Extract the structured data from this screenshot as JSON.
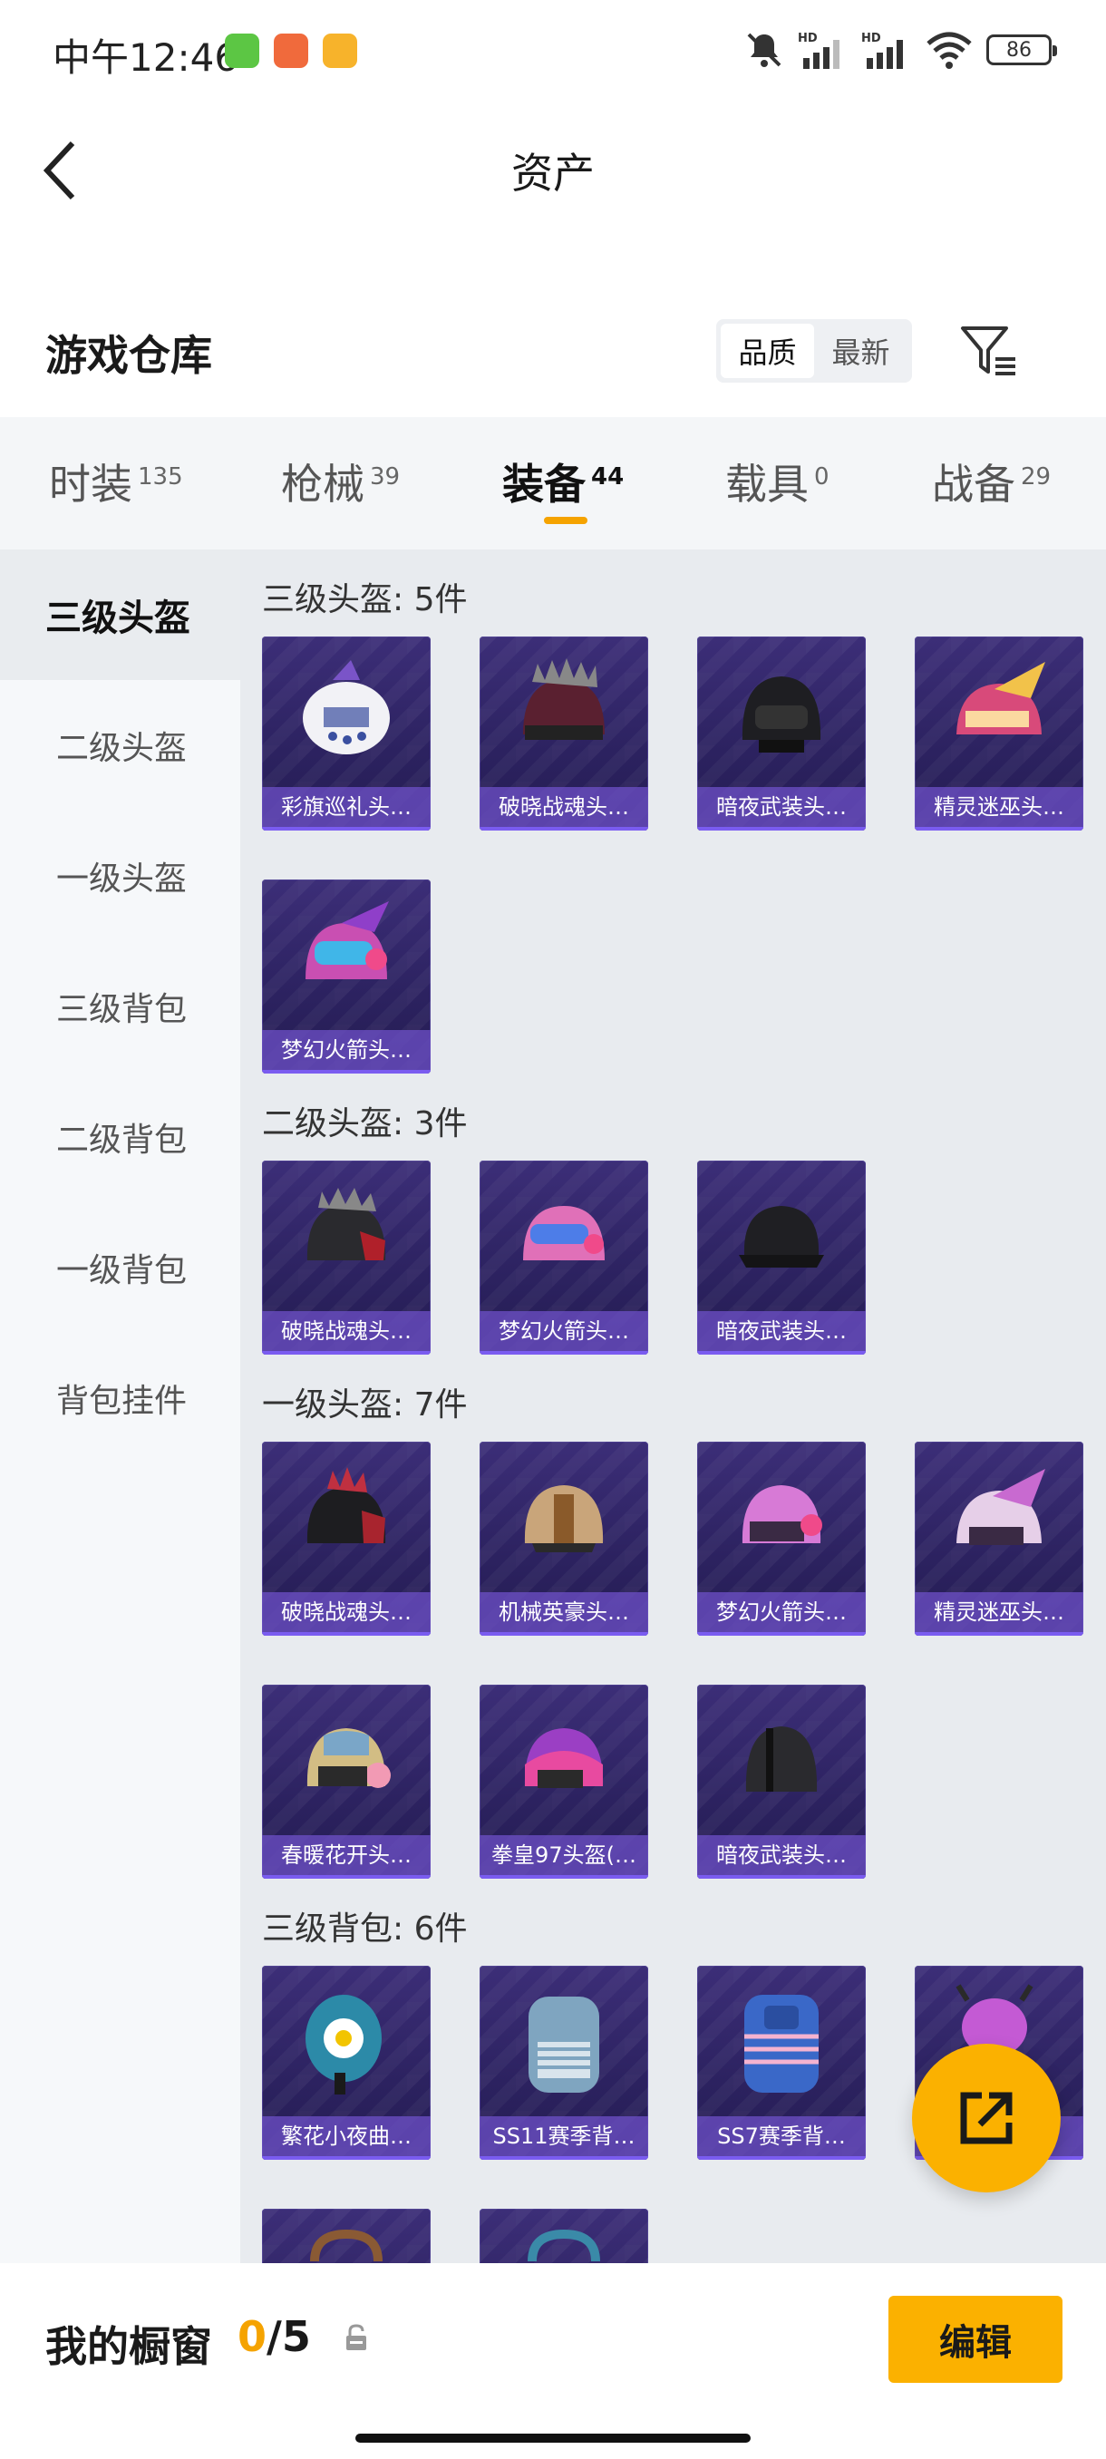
{
  "status_bar": {
    "time": "中午12:46",
    "battery": "86"
  },
  "header": {
    "title": "资产"
  },
  "warehouse": {
    "title": "游戏仓库",
    "sort_options": [
      "品质",
      "最新"
    ]
  },
  "tabs": [
    {
      "label": "时装",
      "count": "135"
    },
    {
      "label": "枪械",
      "count": "39"
    },
    {
      "label": "装备",
      "count": "44"
    },
    {
      "label": "载具",
      "count": "0"
    },
    {
      "label": "战备",
      "count": "29"
    }
  ],
  "sidebar": {
    "items": [
      "三级头盔",
      "二级头盔",
      "一级头盔",
      "三级背包",
      "二级背包",
      "一级背包",
      "背包挂件"
    ]
  },
  "groups": [
    {
      "title": "三级头盔: 5件",
      "items": [
        "彩旗巡礼头…",
        "破晓战魂头…",
        "暗夜武装头…",
        "精灵迷巫头…",
        "梦幻火箭头…"
      ]
    },
    {
      "title": "二级头盔: 3件",
      "items": [
        "破晓战魂头…",
        "梦幻火箭头…",
        "暗夜武装头…"
      ]
    },
    {
      "title": "一级头盔: 7件",
      "items": [
        "破晓战魂头…",
        "机械英豪头…",
        "梦幻火箭头…",
        "精灵迷巫头…",
        "春暖花开头…",
        "拳皇97头盔(…",
        "暗夜武装头…"
      ]
    },
    {
      "title": "三级背包: 6件",
      "items": [
        "繁花小夜曲…",
        "SS11赛季背…",
        "SS7赛季背…",
        ""
      ]
    }
  ],
  "bottom_bar": {
    "showcase_label": "我的橱窗",
    "showcase_current": "0",
    "showcase_total": "/5",
    "edit_label": "编辑"
  },
  "colors": {
    "accent": "#fbb100",
    "card_bg": "#2c2260",
    "card_label": "#6e50c8"
  }
}
